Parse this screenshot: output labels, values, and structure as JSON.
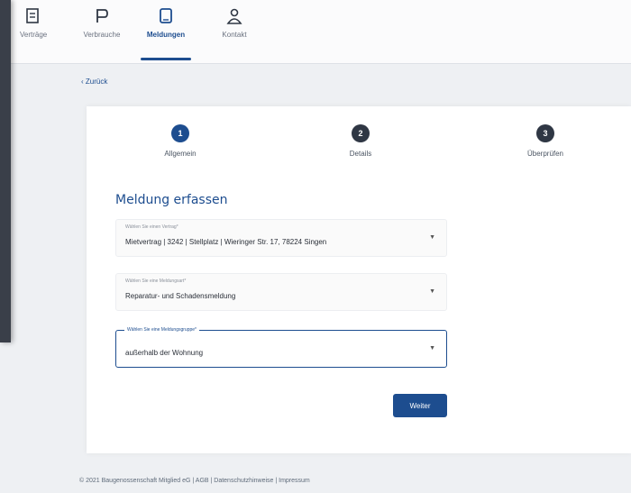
{
  "nav": {
    "items": [
      {
        "label": "Verträge",
        "icon": "contract-icon"
      },
      {
        "label": "Verbrauche",
        "icon": "consumption-icon"
      },
      {
        "label": "Meldungen",
        "icon": "reports-icon"
      },
      {
        "label": "Kontakt",
        "icon": "contact-icon"
      }
    ],
    "active": "Meldungen"
  },
  "back_label": "Zurück",
  "steps": [
    {
      "number": "1",
      "label": "Allgemein"
    },
    {
      "number": "2",
      "label": "Details"
    },
    {
      "number": "3",
      "label": "Überprüfen"
    }
  ],
  "form": {
    "title": "Meldung erfassen",
    "fields": [
      {
        "label": "Wählen Sie einen Vertrag*",
        "value": "Mietvertrag | 3242 | Stellplatz | Wieringer Str. 17, 78224 Singen"
      },
      {
        "label": "Wählen Sie eine Meldungsart*",
        "value": "Reparatur- und Schadensmeldung"
      },
      {
        "label": "Wählen Sie eine Meldungsgruppe*",
        "value": "außerhalb der Wohnung"
      }
    ],
    "next_button": "Weiter"
  },
  "footer": "© 2021 Baugenossenschaft Mitglied eG  |  AGB  |  Datenschutzhinweise  |  Impressum",
  "colors": {
    "accent": "#1d4d8f",
    "step_inactive": "#2f3744"
  }
}
